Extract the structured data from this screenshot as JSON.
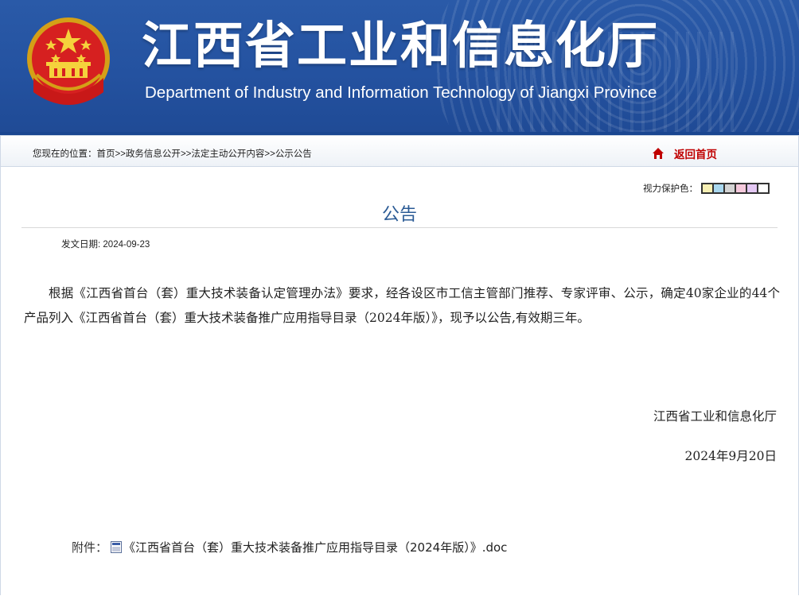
{
  "header": {
    "title": "江西省工业和信息化厅",
    "subtitle": "Department of Industry and Information Technology of Jiangxi Province",
    "emblem_icon": "national-emblem-icon",
    "brand_color": "#2452a0"
  },
  "breadcrumb": {
    "prefix": "您现在的位置：",
    "items": [
      "首页",
      "政务信息公开",
      "法定主动公开内容",
      "公示公告"
    ],
    "separator": ">>"
  },
  "home_link": {
    "label": "返回首页",
    "icon": "home-icon",
    "color": "#c00000"
  },
  "eye_care": {
    "label": "视力保护色：",
    "colors": [
      "#f7f0b4",
      "#a9d7ee",
      "#d4d4d4",
      "#f5c9dc",
      "#e4c8f4",
      "#ffffff"
    ]
  },
  "article": {
    "title": "公告",
    "date_label": "发文日期:",
    "date_value": "2024-09-23",
    "body": "根据《江西省首台（套）重大技术装备认定管理办法》要求，经各设区市工信主管部门推荐、专家评审、公示，确定40家企业的44个产品列入《江西省首台（套）重大技术装备推广应用指导目录（2024年版）》，现予以公告,有效期三年。",
    "signature_org": "江西省工业和信息化厅",
    "signature_date": "2024年9月20日"
  },
  "attachment": {
    "label": "附件：",
    "icon": "word-doc-icon",
    "filename": "《江西省首台（套）重大技术装备推广应用指导目录（2024年版）》.doc"
  }
}
